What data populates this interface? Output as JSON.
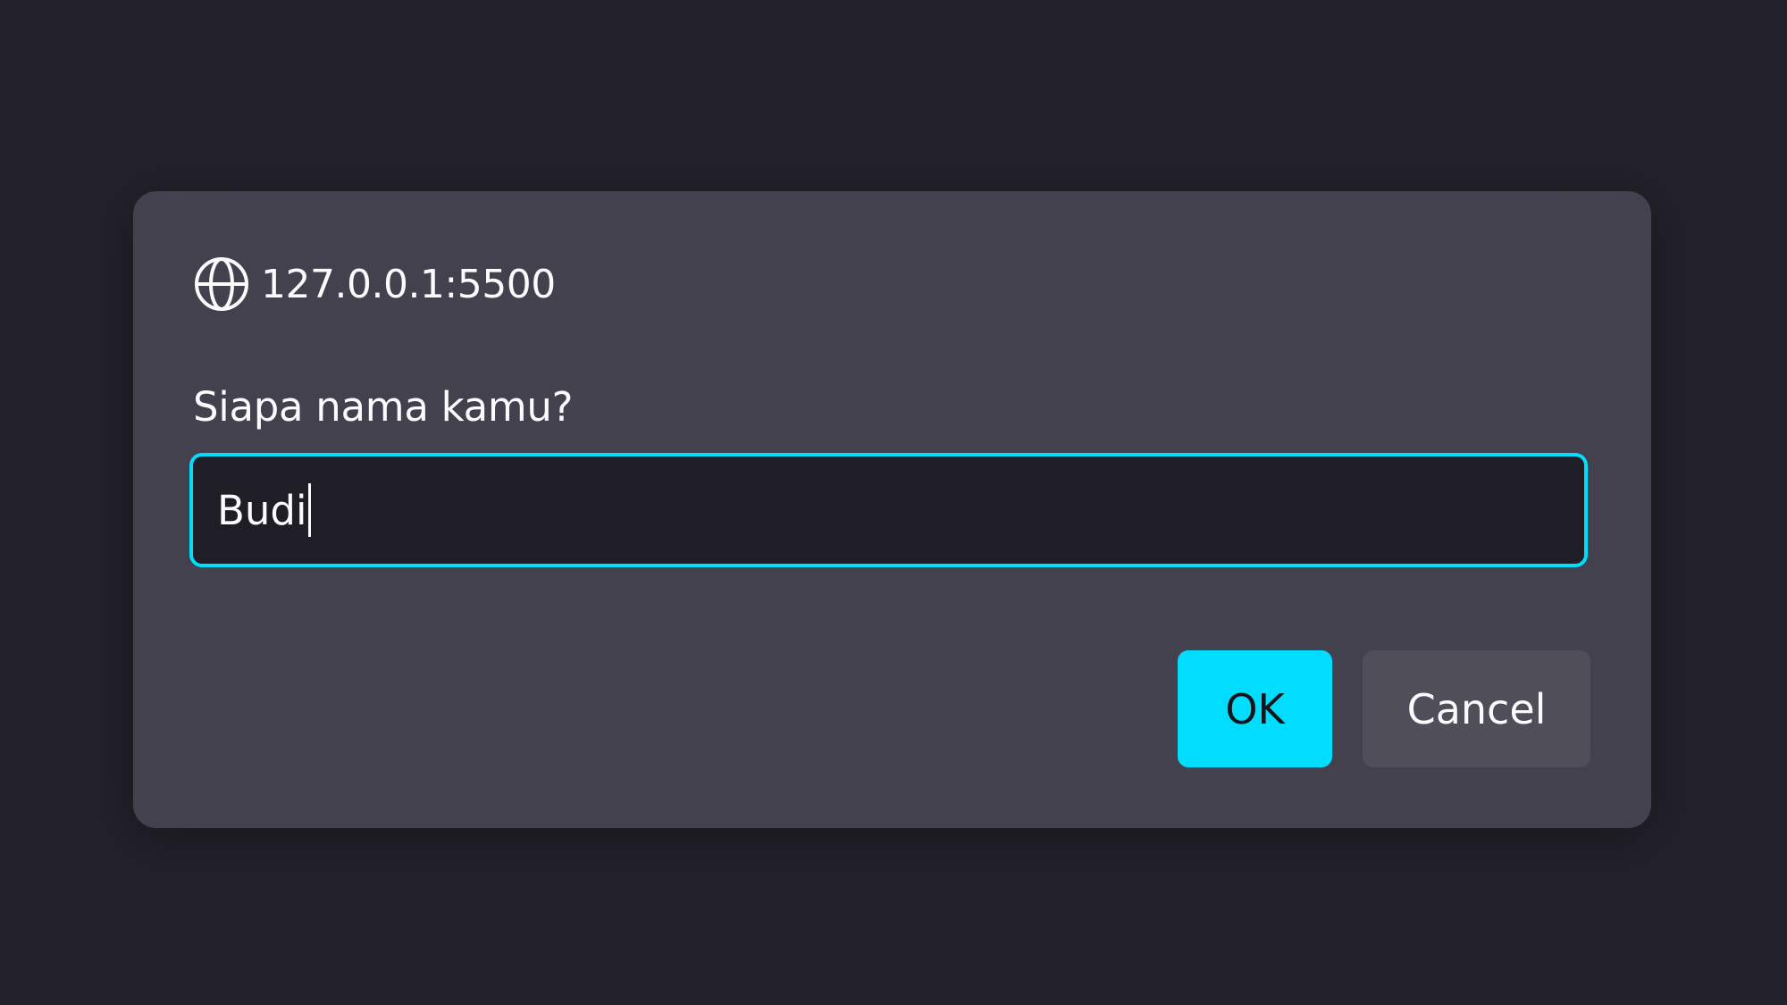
{
  "dialog": {
    "origin": "127.0.0.1:5500",
    "origin_icon": "globe-icon",
    "message": "Siapa nama kamu?",
    "input": {
      "value": "Budi",
      "focused": true
    },
    "buttons": {
      "ok_label": "OK",
      "cancel_label": "Cancel"
    }
  },
  "colors": {
    "background": "#23222b",
    "dialog_background": "#42414d",
    "input_background": "#1f1e26",
    "accent": "#00ddff",
    "secondary_button": "#4f4e59",
    "text": "#fbfbfe"
  }
}
